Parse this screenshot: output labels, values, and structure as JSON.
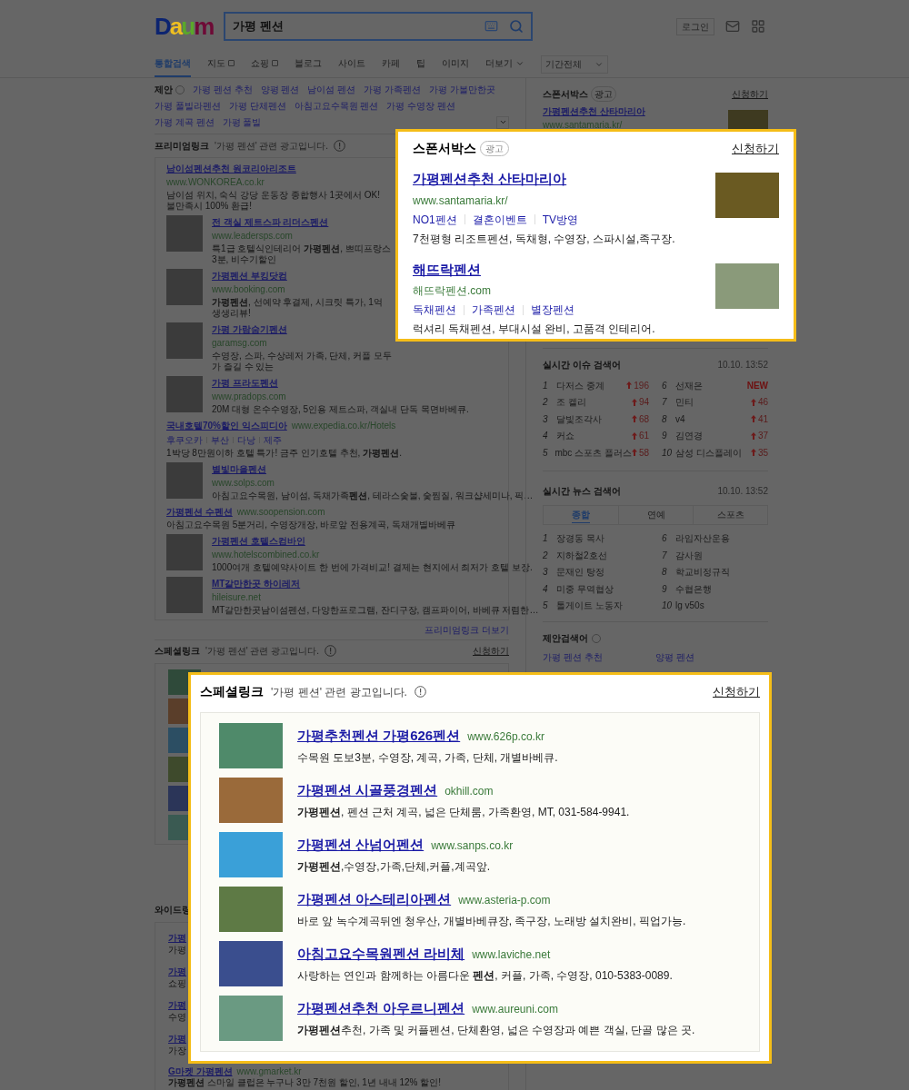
{
  "header": {
    "logo": "Daum",
    "search_value": "가평 펜션",
    "login": "로그인"
  },
  "tabs": [
    {
      "label": "통합검색",
      "selected": true,
      "kind": "plain"
    },
    {
      "label": "지도",
      "selected": false,
      "kind": "box"
    },
    {
      "label": "쇼핑",
      "selected": false,
      "kind": "box"
    },
    {
      "label": "블로그",
      "selected": false,
      "kind": "plain"
    },
    {
      "label": "사이트",
      "selected": false,
      "kind": "plain"
    },
    {
      "label": "카페",
      "selected": false,
      "kind": "plain"
    },
    {
      "label": "팁",
      "selected": false,
      "kind": "plain"
    },
    {
      "label": "이미지",
      "selected": false,
      "kind": "plain"
    },
    {
      "label": "더보기",
      "selected": false,
      "kind": "more"
    }
  ],
  "period_select": "기간전체",
  "suggestions": {
    "label": "제안",
    "rows": [
      [
        "가평 펜션 추천",
        "양평 펜션",
        "남이섬 펜션",
        "가평 가족펜션",
        "가평 가볼만한곳"
      ],
      [
        "가평 풀빌라펜션",
        "가평 단체펜션",
        "아침고요수목원 펜션",
        "가평 수영장 펜션",
        "가평 계곡 펜션",
        "가평 풀빌"
      ]
    ]
  },
  "premium_links": {
    "title": "프리미엄링크",
    "note": "'가평 펜션' 관련 광고입니다.",
    "more": "프리미엄링크 더보기",
    "items": [
      {
        "kind": "text",
        "title": "남이섬펜션추천 원코리아리조트",
        "url": "www.WONKOREA.co.kr",
        "desc": "남이섬 위치, 숙식 강당 운동장 종합행사 1곳에서 OK! 불만족시 100% 환급!"
      },
      {
        "kind": "image",
        "title": "전 객실 제트스파 리더스펜션",
        "url": "www.leadersps.com",
        "desc": "특1급 호텔식인테리어 **가평펜션**, 쁘띠프랑스3분, 비수기할인"
      },
      {
        "kind": "image",
        "title": "가평펜션 부킹닷컴",
        "url": "www.booking.com",
        "desc": "**가평펜션**, 선예약 후결제, 시크릿 특가, 1억 생생리뷰!"
      },
      {
        "kind": "image",
        "title": "가평 가람숨기펜션",
        "url": "garamsg.com",
        "desc": "수영장, 스파, 수상레저 가족, 단체, 커플 모두가 즐길 수 있는"
      },
      {
        "kind": "image",
        "title": "가평 프라도펜션",
        "url": "www.pradops.com",
        "desc": "20M 대형 온수수영장, 5인용 제트스파, 객실내 단독 목면바베큐."
      },
      {
        "kind": "text",
        "title": "국내호텔70%할인 익스피디아",
        "url": "www.expedia.co.kr/Hotels",
        "sublinks": [
          "후쿠오카",
          "부산",
          "다낭",
          "제주"
        ],
        "desc": "1박당 8만원이하 호텔 특가! 금주 인기호텔 추천, **가평펜션**."
      },
      {
        "kind": "image",
        "title": "별빛마을펜션",
        "url": "www.solps.com",
        "desc": "아침고요수목원, 남이섬, 독채가족**펜션**, 테라스숯불, 숯찜질, 워크샵세미나, 픽…"
      },
      {
        "kind": "text",
        "title": "가평펜션 수펜션",
        "url": "www.soopension.com",
        "desc": "아침고요수목원 5분거리, 수영장개장, 바로앞 전용계곡, 독채개별바베큐"
      },
      {
        "kind": "image",
        "title": "가평펜션 호텔스컴바인",
        "url": "www.hotelscombined.co.kr",
        "desc": "1000여개 호텔예약사이트 한 번에 가격비교! 결제는 현지에서 최저가 호텔 보장."
      },
      {
        "kind": "image",
        "title": "MT갈만한곳 하이레저",
        "url": "hileisure.net",
        "desc": "MT갈만한곳남이섬펜션, 다양한프로그램, 잔디구장, 캠프파이어, 바베큐 저렴한…"
      }
    ]
  },
  "special_links_behind": {
    "title": "스페셜링크",
    "note": "'가평 펜션' 관련 광고입니다.",
    "apply": "신청하기"
  },
  "wide_links_behind": {
    "title": "와이드링",
    "items": [
      {
        "title": "가평",
        "desc": "가평"
      },
      {
        "title": "가평",
        "desc": "쇼핑"
      },
      {
        "title": "가평",
        "desc": "수영"
      },
      {
        "title": "가평",
        "desc": "가장"
      }
    ]
  },
  "gmarket": {
    "title": "G마켓 가평펜션",
    "url": "www.gmarket.kr",
    "desc": "**가평펜션** 스마일 클럽은 누구나 3만 7천원 할인, 1년 내내 12% 할인!"
  },
  "sponsor_behind": {
    "title": "스폰서박스",
    "badge": "광고",
    "apply": "신청하기",
    "ad_title": "가평펜션추천 산타마리아",
    "ad_url": "www.santamaria.kr/"
  },
  "issue_search": {
    "title": "실시간 이슈 검색어",
    "time": "10.10. 13:52",
    "items": [
      {
        "rank": "1",
        "term": "다저스 중계",
        "kind": "rise",
        "change": "196"
      },
      {
        "rank": "2",
        "term": "조 켈리",
        "kind": "rise",
        "change": "94"
      },
      {
        "rank": "3",
        "term": "달빛조각사",
        "kind": "rise",
        "change": "68"
      },
      {
        "rank": "4",
        "term": "커쇼",
        "kind": "rise",
        "change": "61"
      },
      {
        "rank": "5",
        "term": "mbc 스포츠 플러스",
        "kind": "rise",
        "change": "58"
      },
      {
        "rank": "6",
        "term": "선재은",
        "kind": "new",
        "change": "NEW"
      },
      {
        "rank": "7",
        "term": "민티",
        "kind": "rise",
        "change": "46"
      },
      {
        "rank": "8",
        "term": "v4",
        "kind": "rise",
        "change": "41"
      },
      {
        "rank": "9",
        "term": "김연경",
        "kind": "rise",
        "change": "37"
      },
      {
        "rank": "10",
        "term": "삼성 디스플레이",
        "kind": "rise",
        "change": "35"
      }
    ]
  },
  "news_search": {
    "title": "실시간 뉴스 검색어",
    "time": "10.10. 13:52",
    "tabs": [
      {
        "label": "종합",
        "selected": true
      },
      {
        "label": "연예",
        "selected": false
      },
      {
        "label": "스포츠",
        "selected": false
      }
    ],
    "items": [
      {
        "rank": "1",
        "term": "장경동 목사"
      },
      {
        "rank": "2",
        "term": "지하철2호선"
      },
      {
        "rank": "3",
        "term": "문재인 탕정"
      },
      {
        "rank": "4",
        "term": "미중 무역협상"
      },
      {
        "rank": "5",
        "term": "톨게이트 노동자"
      },
      {
        "rank": "6",
        "term": "라임자산운용"
      },
      {
        "rank": "7",
        "term": "감사원"
      },
      {
        "rank": "8",
        "term": "학교비정규직"
      },
      {
        "rank": "9",
        "term": "수협은행"
      },
      {
        "rank": "10",
        "term": "lg v50s"
      }
    ]
  },
  "suggested_search": {
    "title": "제안검색어",
    "items": [
      "가평 펜션 추천",
      "양평 펜션"
    ]
  },
  "sponsor_box": {
    "title": "스폰서박스",
    "badge": "광고",
    "apply": "신청하기",
    "ads": [
      {
        "title": "가평펜션추천 산타마리아",
        "url": "www.santamaria.kr/",
        "links": [
          "NO1펜션",
          "결혼이벤트",
          "TV방영"
        ],
        "desc": "7천평형 리조트펜션, 독채형, 수영장, 스파시설,족구장."
      },
      {
        "title": "해뜨락펜션",
        "url": "해뜨락펜션.com",
        "links": [
          "독채펜션",
          "가족펜션",
          "별장펜션"
        ],
        "desc": "럭셔리 독채펜션, 부대시설 완비, 고품격 인테리어."
      }
    ]
  },
  "special_links": {
    "title": "스페셜링크",
    "note": "'가평 펜션' 관련 광고입니다.",
    "apply": "신청하기",
    "items": [
      {
        "title": "가평추천펜션 가평626펜션",
        "url": "www.626p.co.kr",
        "desc": "수목원 도보3분, 수영장, 계곡, 가족, 단체, 개별바베큐."
      },
      {
        "title": "가평펜션 시골풍경펜션",
        "url": "okhill.com",
        "desc": "**가평펜션**, 펜션 근처 계곡, 넓은 단체룸, 가족환영, MT, 031-584-9941."
      },
      {
        "title": "가평펜션 산넘어펜션",
        "url": "www.sanps.co.kr",
        "desc": "**가평펜션**,수영장,가족,단체,커플,계곡앞."
      },
      {
        "title": "가평펜션 아스테리아펜션",
        "url": "www.asteria-p.com",
        "desc": "바로 앞 녹수계곡뒤엔 청우산, 개별바베큐장, 족구장, 노래방 설치완비, 픽업가능."
      },
      {
        "title": "아침고요수목원펜션 라비체",
        "url": "www.laviche.net",
        "desc": "사랑하는 연인과 함께하는 아름다운 **펜션**, 커플, 가족, 수영장, 010-5383-0089."
      },
      {
        "title": "가평펜션추천 아우르니펜션",
        "url": "www.aureuni.com",
        "desc": "**가평펜션**추천, 가족 및 커플펜션, 단체환영, 넓은 수영장과 예쁜 객실, 단골 많은 곳."
      }
    ]
  }
}
